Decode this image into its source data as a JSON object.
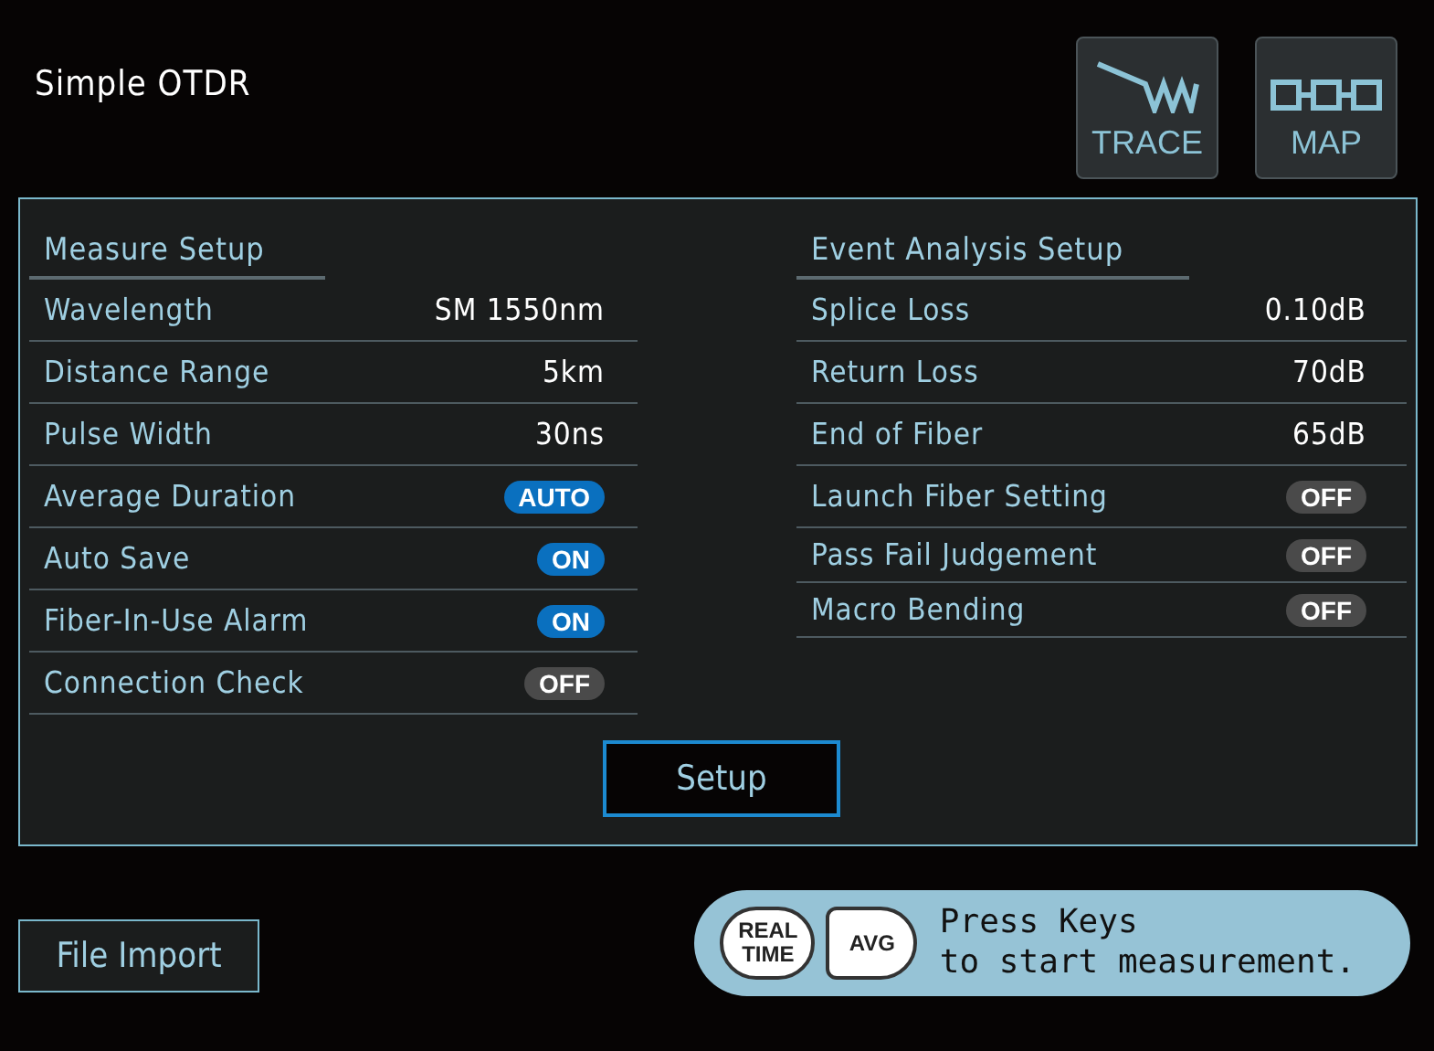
{
  "window": {
    "title": "Simple OTDR"
  },
  "view_buttons": [
    {
      "kind": "trace",
      "label": "TRACE"
    },
    {
      "kind": "map",
      "label": "MAP"
    }
  ],
  "sections": [
    {
      "title": "Measure Setup",
      "rows": [
        {
          "kind": "value",
          "label": "Wavelength",
          "value": "SM 1550nm"
        },
        {
          "kind": "value",
          "label": "Distance Range",
          "value": "5km"
        },
        {
          "kind": "value",
          "label": "Pulse Width",
          "value": "30ns"
        },
        {
          "kind": "toggle",
          "label": "Average Duration",
          "value": "AUTO",
          "on": true
        },
        {
          "kind": "toggle",
          "label": "Auto Save",
          "value": "ON",
          "on": true
        },
        {
          "kind": "toggle",
          "label": "Fiber-In-Use Alarm",
          "value": "ON",
          "on": true
        },
        {
          "kind": "toggle",
          "label": "Connection Check",
          "value": "OFF",
          "on": false
        }
      ]
    },
    {
      "title": "Event Analysis Setup",
      "rows": [
        {
          "kind": "value",
          "label": "Splice Loss",
          "value": "0.10dB"
        },
        {
          "kind": "value",
          "label": "Return Loss",
          "value": "70dB"
        },
        {
          "kind": "value",
          "label": "End of Fiber",
          "value": "65dB"
        },
        {
          "kind": "toggle",
          "label": "Launch Fiber Setting",
          "value": "OFF",
          "on": false
        },
        {
          "kind": "toggle",
          "label": "Pass Fail Judgement",
          "value": "OFF",
          "on": false
        },
        {
          "kind": "toggle",
          "label": "Macro Bending",
          "value": "OFF",
          "on": false
        }
      ]
    }
  ],
  "setup_button": "Setup",
  "file_import_button": "File Import",
  "hint": {
    "keys": [
      {
        "lines": [
          "REAL",
          "TIME"
        ]
      },
      {
        "lines": [
          "AVG"
        ]
      }
    ],
    "lines": [
      "Press Keys",
      "to start measurement."
    ]
  }
}
